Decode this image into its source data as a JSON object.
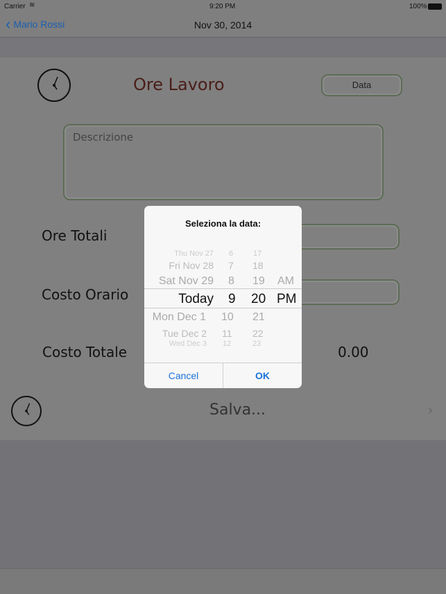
{
  "status": {
    "carrier": "Carrier",
    "time": "9:20 PM",
    "battery": "100%"
  },
  "nav": {
    "back_label": "Mario Rossi",
    "title": "Nov 30, 2014"
  },
  "form": {
    "title": "Ore Lavoro",
    "date_button": "Data",
    "description_placeholder": "Descrizione",
    "ore_totali_label": "Ore Totali",
    "costo_orario_label": "Costo Orario",
    "costo_totale_label": "Costo Totale",
    "costo_totale_value": "0.00",
    "save_label": "Salva..."
  },
  "dialog": {
    "title": "Seleziona la data:",
    "days": [
      "Thu Nov 27",
      "Fri Nov 28",
      "Sat Nov 29",
      "Today",
      "Mon Dec 1",
      "Tue Dec 2",
      "Wed Dec 3"
    ],
    "hours": [
      "6",
      "7",
      "8",
      "9",
      "10",
      "11",
      "12"
    ],
    "minutes": [
      "17",
      "18",
      "19",
      "20",
      "21",
      "22",
      "23"
    ],
    "ampm": [
      "AM",
      "PM"
    ],
    "selected": {
      "day": "Today",
      "hour": "9",
      "minute": "20",
      "ampm": "PM"
    },
    "cancel": "Cancel",
    "ok": "OK"
  }
}
